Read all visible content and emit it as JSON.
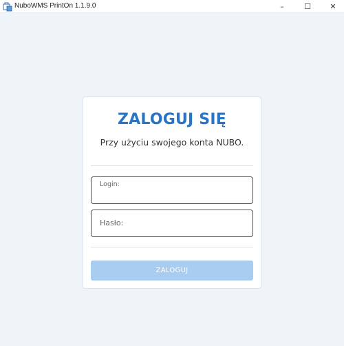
{
  "window": {
    "title": "NuboWMS PrintOn 1.1.9.0",
    "icon": "printer-app-icon",
    "controls": {
      "minimize": "–",
      "maximize": "☐",
      "close": "✕"
    }
  },
  "login_card": {
    "heading": "ZALOGUJ SIĘ",
    "subheading": "Przy użyciu swojego konta NUBO.",
    "login_field": {
      "label": "Login:",
      "value": ""
    },
    "password_field": {
      "label": "Hasło:",
      "value": ""
    },
    "submit_label": "ZALOGUJ"
  },
  "colors": {
    "heading": "#2a74c5",
    "button_disabled": "#a9cdf0",
    "background": "#eff4f9"
  }
}
